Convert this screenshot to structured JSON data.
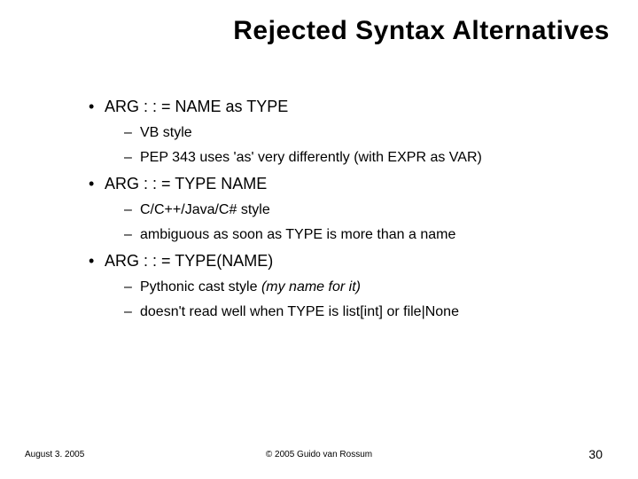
{
  "title": "Rejected Syntax Alternatives",
  "bullets": [
    {
      "text": "ARG : : = NAME as TYPE",
      "sub": [
        {
          "text": "VB style",
          "italic_tail": ""
        },
        {
          "text": "PEP 343 uses 'as' very differently (with EXPR as VAR)",
          "italic_tail": ""
        }
      ]
    },
    {
      "text": "ARG : : = TYPE NAME",
      "sub": [
        {
          "text": "C/C++/Java/C# style",
          "italic_tail": ""
        },
        {
          "text": "ambiguous as soon as TYPE is more than a name",
          "italic_tail": ""
        }
      ]
    },
    {
      "text": "ARG : : = TYPE(NAME)",
      "sub": [
        {
          "text": "Pythonic cast style ",
          "italic_tail": "(my name for it)"
        },
        {
          "text": "doesn't read well when TYPE is list[int] or file|None",
          "italic_tail": ""
        }
      ]
    }
  ],
  "footer": {
    "date": "August 3. 2005",
    "copyright": "© 2005 Guido van Rossum",
    "page": "30"
  }
}
